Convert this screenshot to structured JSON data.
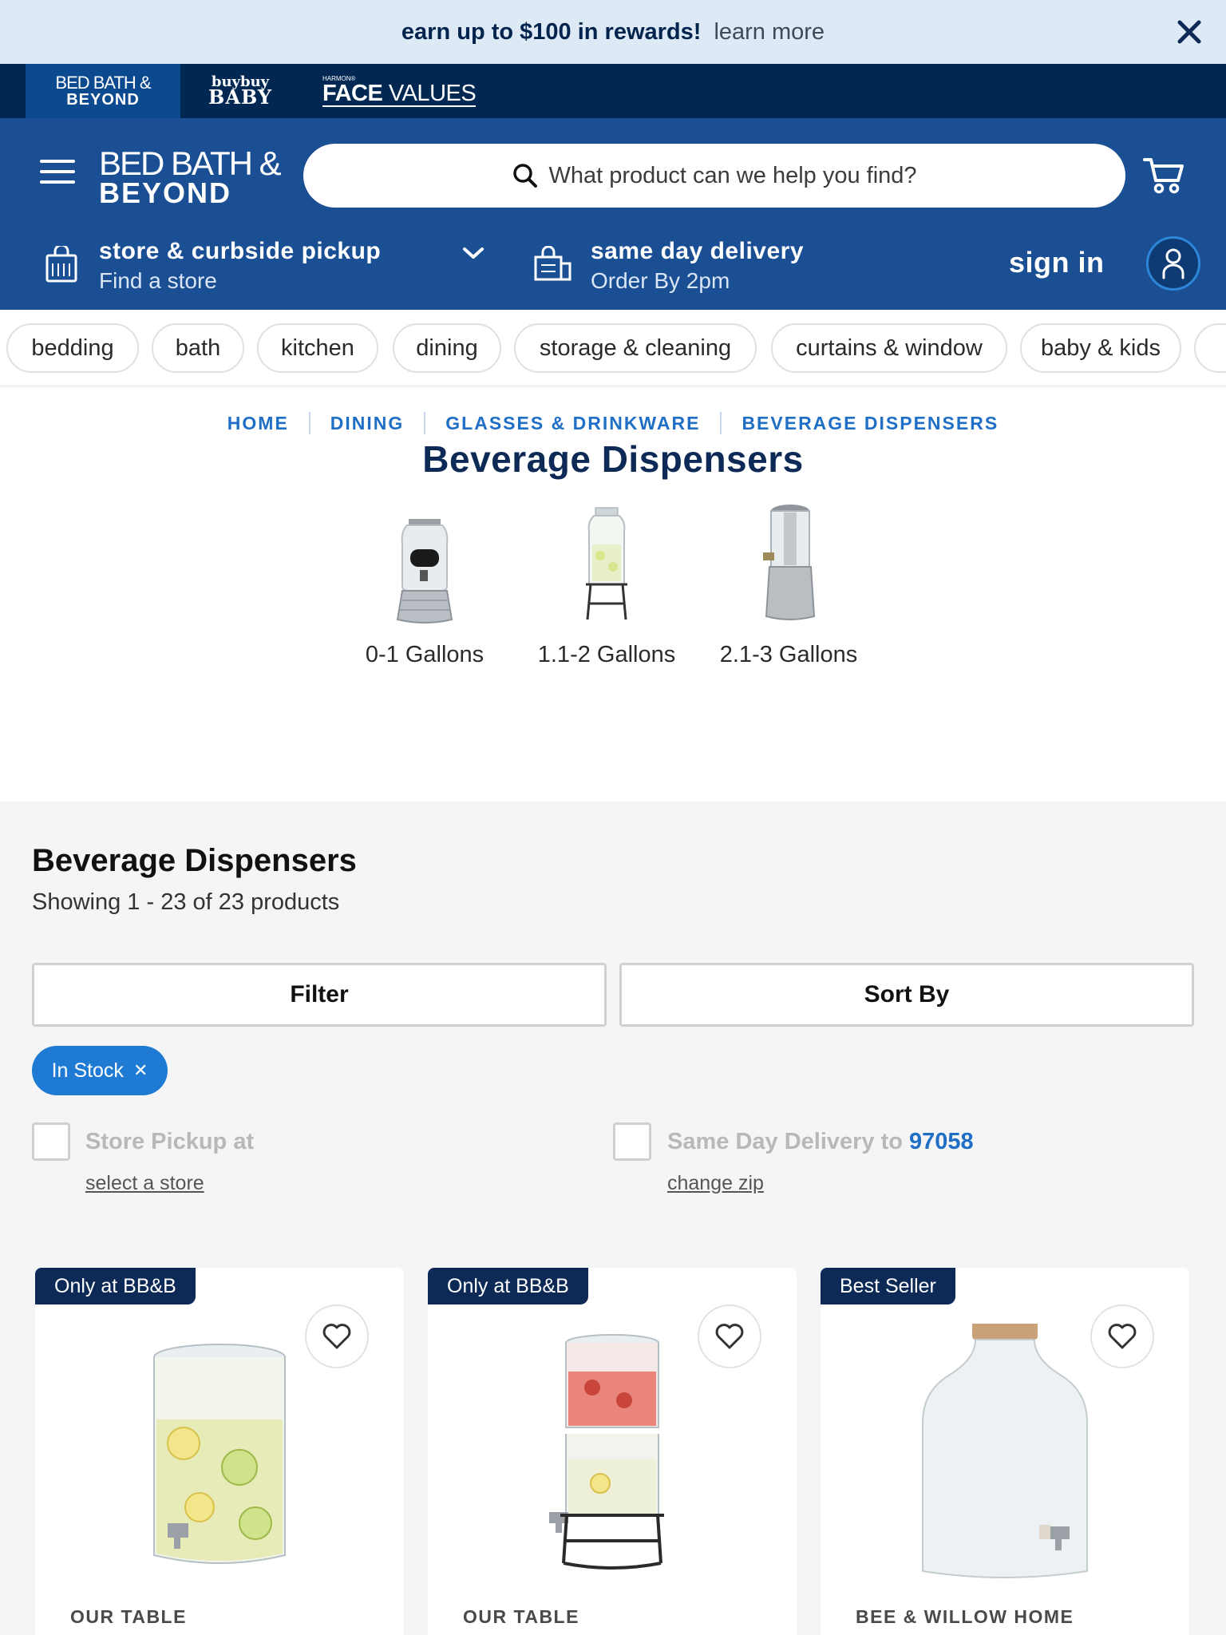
{
  "promo": {
    "text": "earn up to $100 in rewards!",
    "link": "learn more"
  },
  "brands": {
    "bbb": {
      "line1": "BED BATH &",
      "line2": "BEYOND"
    },
    "baby": {
      "line1": "buybuy",
      "line2": "BABY"
    },
    "face_values": {
      "line1": "HARMON®",
      "line2a": "FACE",
      "line2b": " VALUES"
    }
  },
  "header": {
    "logo_line1": "BED BATH &",
    "logo_line2": "BEYOND",
    "search_placeholder": "What product can we help you find?",
    "pickup_title": "store & curbside pickup",
    "pickup_sub": "Find a store",
    "sameday_title": "same day delivery",
    "sameday_sub": "Order By 2pm",
    "signin": "sign in"
  },
  "categories": [
    "bedding",
    "bath",
    "kitchen",
    "dining",
    "storage & cleaning",
    "curtains & window",
    "baby & kids"
  ],
  "breadcrumb": [
    "HOME",
    "DINING",
    "GLASSES & DRINKWARE",
    "BEVERAGE DISPENSERS"
  ],
  "page_title": "Beverage Dispensers",
  "capacity_filters": [
    {
      "label": "0-1 Gallons"
    },
    {
      "label": "1.1-2 Gallons"
    },
    {
      "label": "2.1-3 Gallons"
    }
  ],
  "listing": {
    "title": "Beverage Dispensers",
    "count": "Showing 1 - 23 of 23 products",
    "filter_label": "Filter",
    "sort_label": "Sort By",
    "active_chip": "In Stock",
    "store_pickup_label": "Store Pickup at",
    "store_pickup_link": "select a store",
    "same_day_label": "Same Day Delivery to ",
    "same_day_zip": "97058",
    "same_day_link": "change zip"
  },
  "products": [
    {
      "badge": "Only at BB&B",
      "brand": "OUR TABLE"
    },
    {
      "badge": "Only at BB&B",
      "brand": "OUR TABLE"
    },
    {
      "badge": "Best Seller",
      "brand": "BEE & WILLOW HOME"
    }
  ],
  "colors": {
    "header_blue": "#1b4f94",
    "navy": "#002853",
    "link_blue": "#1f6fc6",
    "promo_bg": "#dde9f4"
  }
}
